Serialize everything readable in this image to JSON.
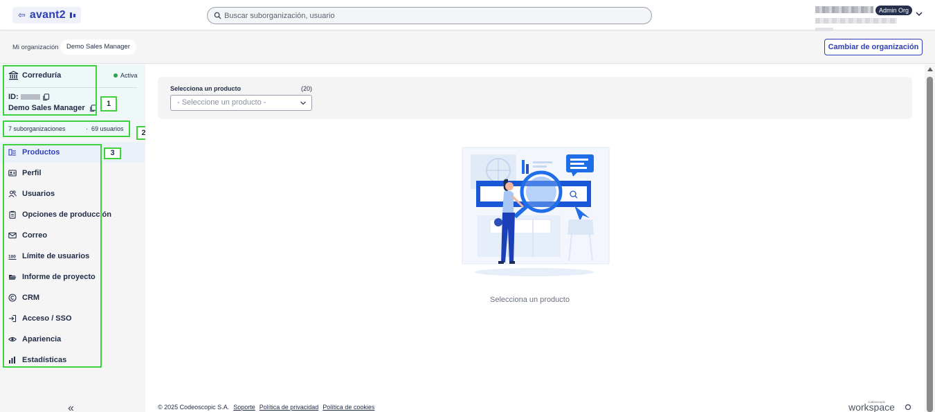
{
  "header": {
    "logo_text": "avant2",
    "search_placeholder": "Buscar suborganización, usuario",
    "user_role_badge": "Admin Org"
  },
  "subheader": {
    "breadcrumb": [
      "Mi organización",
      "Demo Sales Manager"
    ],
    "change_org_label": "Cambiar de organización"
  },
  "org": {
    "type": "Correduría",
    "status": "Activa",
    "id_label": "ID:",
    "name": "Demo Sales Manager",
    "suborganizations": "7 suborganizaciones",
    "separator": "·",
    "users": "69 usuarios"
  },
  "sidebar": {
    "items": [
      {
        "label": "Productos",
        "icon": "products-icon",
        "active": true
      },
      {
        "label": "Perfil",
        "icon": "profile-card-icon"
      },
      {
        "label": "Usuarios",
        "icon": "users-icon"
      },
      {
        "label": "Opciones de producción",
        "icon": "clipboard-icon"
      },
      {
        "label": "Correo",
        "icon": "mail-icon"
      },
      {
        "label": "Límite de usuarios",
        "icon": "limit-100-icon"
      },
      {
        "label": "Informe de proyecto",
        "icon": "folder-open-icon"
      },
      {
        "label": "CRM",
        "icon": "copyright-icon"
      },
      {
        "label": "Acceso / SSO",
        "icon": "login-icon"
      },
      {
        "label": "Apariencia",
        "icon": "eye-icon"
      },
      {
        "label": "Estadísticas",
        "icon": "bar-chart-icon"
      }
    ],
    "collapse_glyph": "«"
  },
  "annotations": [
    "1",
    "2",
    "3"
  ],
  "main": {
    "product_select_label": "Selecciona un producto",
    "product_count": "(20)",
    "product_select_placeholder": "- Seleccione un producto -",
    "empty_state_text": "Selecciona un producto"
  },
  "footer": {
    "copyright": "© 2025 Codeoscopic S.A.",
    "links": [
      "Soporte",
      "Política de privacidad",
      "Política de cookies"
    ],
    "brand_small": "codeoscopic",
    "brand": "workspace"
  },
  "colors": {
    "accent": "#2d3eb8",
    "status_active": "#2fa14f",
    "annotation": "#3dd23d",
    "badge_bg": "#26304d"
  }
}
